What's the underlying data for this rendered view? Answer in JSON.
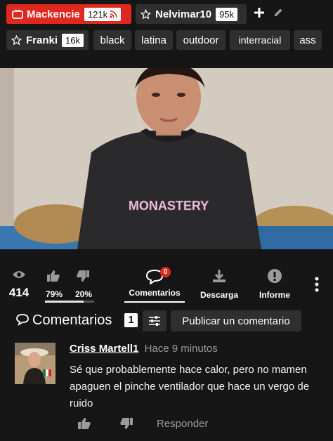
{
  "tags_row1": {
    "channel": {
      "label": "Mackencie",
      "count": "121k"
    },
    "star": {
      "label": "Nelvimar10",
      "count": "95k"
    }
  },
  "tags_row2": {
    "star": {
      "label": "Franki",
      "count": "16k"
    },
    "categories": [
      "black",
      "latina",
      "outdoor",
      "interracial",
      "ass"
    ]
  },
  "video": {
    "shirt_text": "MONASTERY"
  },
  "stats": {
    "views": "414",
    "likes_pct": "79%",
    "dislikes_pct": "20%",
    "likes_ratio": 0.79,
    "comments_badge": "0",
    "comments_label": "Comentarios",
    "download_label": "Descarga",
    "report_label": "Informe"
  },
  "comments": {
    "title": "Comentarios",
    "count": "1",
    "post_button": "Publicar un comentario",
    "items": [
      {
        "author": "Criss Martell1",
        "time": "Hace 9 minutos",
        "text": "Sé que probablemente hace calor, pero no mamen apaguen el pinche ventilador que hace un vergo de ruido",
        "reply_label": "Responder"
      }
    ]
  },
  "colors": {
    "accent_red": "#e0281e",
    "chip_grey": "#2f2f2f",
    "background": "#161616"
  }
}
